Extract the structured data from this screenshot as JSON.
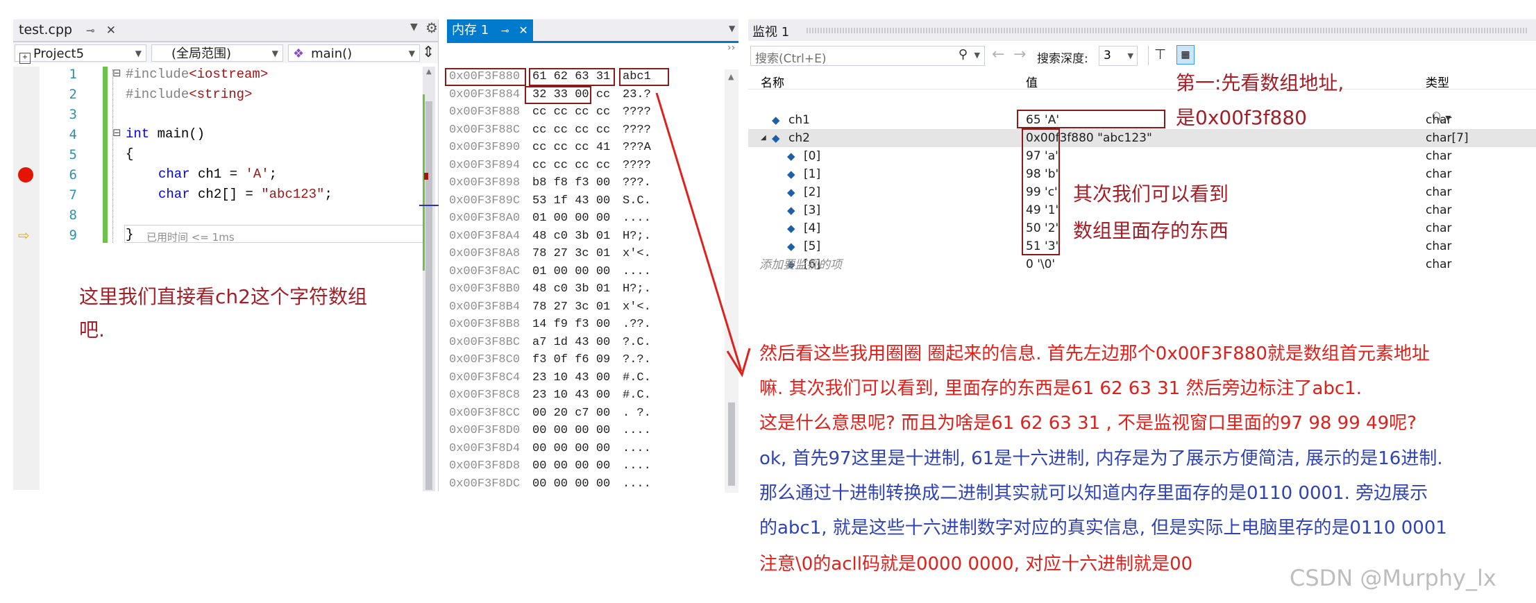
{
  "editor": {
    "tab_label": "test.cpp",
    "pin_glyph": "⊸",
    "close_glyph": "✕",
    "project": "Project5",
    "scope": "(全局范围)",
    "function": "main()",
    "line_numbers": [
      "1",
      "2",
      "3",
      "4",
      "5",
      "6",
      "7",
      "8",
      "9"
    ],
    "lines": {
      "l1_pre": "#include",
      "l1_hdr": "<iostream>",
      "l2_pre": "#include",
      "l2_hdr": "<string>",
      "l4_kw": "int",
      "l4_rest": " main()",
      "l5": "{",
      "l6_kw": "char",
      "l6_mid": " ch1 = ",
      "l6_str": "'A'",
      "l6_end": ";",
      "l7_kw": "char",
      "l7_mid": " ch2[] = ",
      "l7_str": "\"abc123\"",
      "l7_end": ";",
      "l9": "}",
      "elapsed": "已用时间 <= 1ms"
    }
  },
  "memory": {
    "tab_label": "内存 1",
    "rows": [
      {
        "addr": "0x00F3F880",
        "bytes": "61 62 63 31",
        "chars": "abc1"
      },
      {
        "addr": "0x00F3F884",
        "bytes": "32 33 00 cc",
        "chars": "23.?"
      },
      {
        "addr": "0x00F3F888",
        "bytes": "cc cc cc cc",
        "chars": "????"
      },
      {
        "addr": "0x00F3F88C",
        "bytes": "cc cc cc cc",
        "chars": "????"
      },
      {
        "addr": "0x00F3F890",
        "bytes": "cc cc cc 41",
        "chars": "???A"
      },
      {
        "addr": "0x00F3F894",
        "bytes": "cc cc cc cc",
        "chars": "????"
      },
      {
        "addr": "0x00F3F898",
        "bytes": "b8 f8 f3 00",
        "chars": "???."
      },
      {
        "addr": "0x00F3F89C",
        "bytes": "53 1f 43 00",
        "chars": "S.C."
      },
      {
        "addr": "0x00F3F8A0",
        "bytes": "01 00 00 00",
        "chars": "...."
      },
      {
        "addr": "0x00F3F8A4",
        "bytes": "48 c0 3b 01",
        "chars": "H?;."
      },
      {
        "addr": "0x00F3F8A8",
        "bytes": "78 27 3c 01",
        "chars": "x'<."
      },
      {
        "addr": "0x00F3F8AC",
        "bytes": "01 00 00 00",
        "chars": "...."
      },
      {
        "addr": "0x00F3F8B0",
        "bytes": "48 c0 3b 01",
        "chars": "H?;."
      },
      {
        "addr": "0x00F3F8B4",
        "bytes": "78 27 3c 01",
        "chars": "x'<."
      },
      {
        "addr": "0x00F3F8B8",
        "bytes": "14 f9 f3 00",
        "chars": ".??."
      },
      {
        "addr": "0x00F3F8BC",
        "bytes": "a7 1d 43 00",
        "chars": "?.C."
      },
      {
        "addr": "0x00F3F8C0",
        "bytes": "f3 0f f6 09",
        "chars": "?.?."
      },
      {
        "addr": "0x00F3F8C4",
        "bytes": "23 10 43 00",
        "chars": "#.C."
      },
      {
        "addr": "0x00F3F8C8",
        "bytes": "23 10 43 00",
        "chars": "#.C."
      },
      {
        "addr": "0x00F3F8CC",
        "bytes": "00 20 c7 00",
        "chars": ". ?."
      },
      {
        "addr": "0x00F3F8D0",
        "bytes": "00 00 00 00",
        "chars": "...."
      },
      {
        "addr": "0x00F3F8D4",
        "bytes": "00 00 00 00",
        "chars": "...."
      },
      {
        "addr": "0x00F3F8D8",
        "bytes": "00 00 00 00",
        "chars": "...."
      },
      {
        "addr": "0x00F3F8DC",
        "bytes": "00 00 00 00",
        "chars": "...."
      }
    ]
  },
  "watch": {
    "tab_label": "监视 1",
    "search_placeholder": "搜索(Ctrl+E)",
    "search_depth_label": "搜索深度:",
    "search_depth_value": "3",
    "col_name": "名称",
    "col_value": "值",
    "col_type": "类型",
    "rows": [
      {
        "name": "ch1",
        "value": "65 'A'",
        "type": "char"
      },
      {
        "name": "ch2",
        "value": "0x00f3f880 \"abc123\"",
        "type": "char[7]"
      },
      {
        "name": "[0]",
        "value": "97 'a'",
        "type": "char"
      },
      {
        "name": "[1]",
        "value": "98 'b'",
        "type": "char"
      },
      {
        "name": "[2]",
        "value": "99 'c'",
        "type": "char"
      },
      {
        "name": "[3]",
        "value": "49 '1'",
        "type": "char"
      },
      {
        "name": "[4]",
        "value": "50 '2'",
        "type": "char"
      },
      {
        "name": "[5]",
        "value": "51 '3'",
        "type": "char"
      },
      {
        "name": "[6]",
        "value": "0 '\\0'",
        "type": "char"
      }
    ],
    "add_watch": "添加要监视的项"
  },
  "annotations": {
    "left_note_1": "这里我们直接看ch2这个字符数组",
    "left_note_2": "吧.",
    "step1_a": "第一:先看数组地址,",
    "step1_b": "是0x00f3f880",
    "step2_a": "其次我们可以看到",
    "step2_b": "数组里面存的东西",
    "red_1": "然后看这些我用圈圈 圈起来的信息. 首先左边那个0x00F3F880就是数组首元素地址",
    "red_2": "嘛. 其次我们可以看到, 里面存的东西是61 62 63 31  然后旁边标注了abc1.",
    "red_3": "这是什么意思呢? 而且为啥是61 62 63 31 , 不是监视窗口里面的97 98 99 49呢?",
    "blue_1": "ok, 首先97这里是十进制, 61是十六进制, 内存是为了展示方便简洁, 展示的是16进制.",
    "blue_2": "那么通过十进制转换成二进制其实就可以知道内存里面存的是0110 0001.   旁边展示",
    "blue_3": "的abc1, 就是这些十六进制数字对应的真实信息, 但是实际上电脑里存的是0110 0001",
    "red_4": "注意\\0的acll码就是0000 0000, 对应十六进制就是00",
    "watermark": "CSDN @Murphy_lx"
  },
  "colors": {
    "annotation_red": "#e0201b",
    "annotation_dark_red": "#a31f28",
    "annotation_blue": "#2f43b5",
    "box_red": "#8b1a1a",
    "vs_blue": "#007acc"
  }
}
